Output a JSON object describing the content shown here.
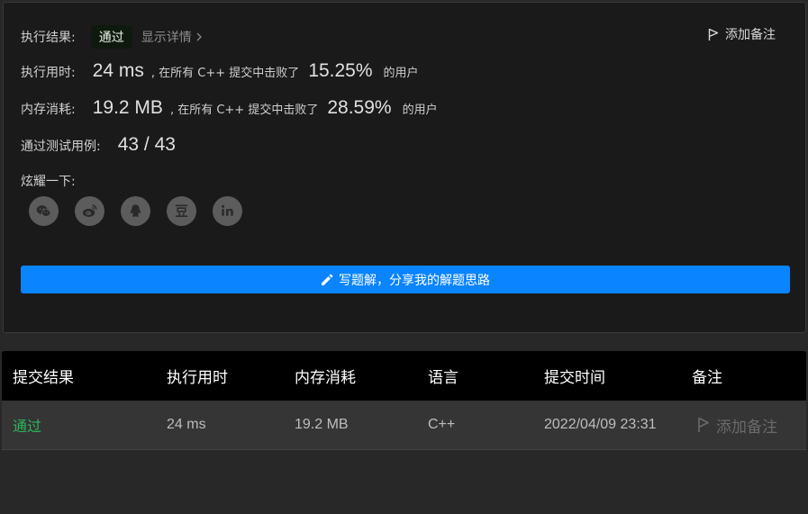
{
  "result": {
    "status_label": "执行结果:",
    "status_value": "通过",
    "detail_link": "显示详情",
    "add_note": "添加备注",
    "runtime": {
      "label": "执行用时:",
      "value": "24 ms",
      "mid_text": ", 在所有 C++ 提交中击败了",
      "percent": "15.25%",
      "suffix": "的用户"
    },
    "memory": {
      "label": "内存消耗:",
      "value": "19.2 MB",
      "mid_text": ", 在所有 C++ 提交中击败了",
      "percent": "28.59%",
      "suffix": "的用户"
    },
    "testcases": {
      "label": "通过测试用例:",
      "value": "43 / 43"
    },
    "share_label": "炫耀一下:",
    "share_icons": [
      "wechat-icon",
      "weibo-icon",
      "qq-icon",
      "douban-icon",
      "linkedin-icon"
    ],
    "write_button": "写题解，分享我的解题思路"
  },
  "table": {
    "headers": {
      "result": "提交结果",
      "runtime": "执行用时",
      "memory": "内存消耗",
      "language": "语言",
      "time": "提交时间",
      "note": "备注"
    },
    "rows": [
      {
        "result": "通过",
        "runtime": "24 ms",
        "memory": "19.2 MB",
        "language": "C++",
        "time": "2022/04/09 23:31",
        "note": "添加备注"
      }
    ]
  },
  "colors": {
    "accent": "#0a84ff",
    "success": "#2db55d",
    "panel": "#1a1a1a",
    "background": "#282828"
  }
}
